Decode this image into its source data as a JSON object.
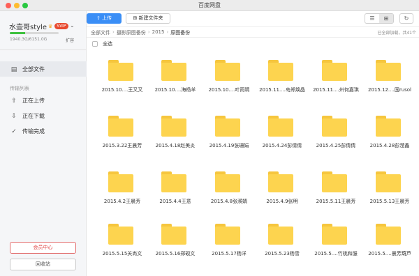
{
  "window": {
    "title": "百度网盘"
  },
  "user": {
    "name": "水壶哥style",
    "vip_badge": "SVIP",
    "quota_text": "1940.3G/6151.0G",
    "quota_used_fraction": 0.32,
    "expand_label": "扩容"
  },
  "sidebar": {
    "items": [
      {
        "label": "全部文件",
        "icon": "folder-icon"
      },
      {
        "label": "正在上传",
        "icon": "upload-icon"
      },
      {
        "label": "正在下载",
        "icon": "download-icon"
      },
      {
        "label": "传输完成",
        "icon": "check-circle-icon"
      }
    ],
    "section_label": "传输列表",
    "vip_center": "会员中心",
    "recycle": "回收站"
  },
  "toolbar": {
    "upload": "上传",
    "new_folder": "新建文件夹"
  },
  "breadcrumb": {
    "items": [
      "全部文件",
      "摄影原图备份",
      "2015",
      "原图备份"
    ],
    "status": "已全部加载，共41个"
  },
  "select_all": "全选",
  "folders": [
    "2015.10....王又又",
    "2015.10....海杨羊",
    "2015.10....叶雨晴",
    "2015.11....岛郑焕晶",
    "2015.11....州何嘉琪",
    "2015.12....国rusol",
    "2015.3.22王晨芳",
    "2015.4.18赵美炎",
    "2015.4.19张珊娟",
    "2015.4.24彭倩倩",
    "2015.4.25彭倩倩",
    "2015.4.28彭滢鑫",
    "2015.4.2王晨芳",
    "2015.4.4王意",
    "2015.4.8张漪婧",
    "2015.4.9张明",
    "2015.5.11王晨芳",
    "2015.5.13王晨芳",
    "2015.5.15关尚文",
    "2015.5.16郑砚文",
    "2015.5.17杨洋",
    "2015.5.23杨雪",
    "2015.5....竹桃和服",
    "2015.5....晨芳葫芦"
  ]
}
